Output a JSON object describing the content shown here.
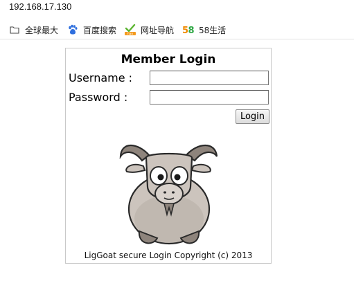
{
  "browser": {
    "address": "192.168.17.130",
    "bookmarks": [
      {
        "label": "全球最大",
        "icon": "folder-icon"
      },
      {
        "label": "百度搜索",
        "icon": "baidu-paw-icon"
      },
      {
        "label": "网址导航",
        "icon": "hao123-icon"
      },
      {
        "label": "58生活",
        "icon": "58-icon"
      }
    ]
  },
  "login": {
    "title": "Member Login",
    "username_label": "Username :",
    "password_label": "Password  :",
    "username_value": "",
    "password_value": "",
    "button_label": "Login",
    "copyright": "LigGoat secure Login Copyright (c) 2013"
  },
  "colors": {
    "panel_border": "#c9c9c9",
    "goat_fur": "#ccc4bd",
    "goat_dark": "#8e847c",
    "baidu_blue": "#2f6fde",
    "hao123_green": "#5cb531",
    "fiftyeight_orange": "#f08a00"
  }
}
